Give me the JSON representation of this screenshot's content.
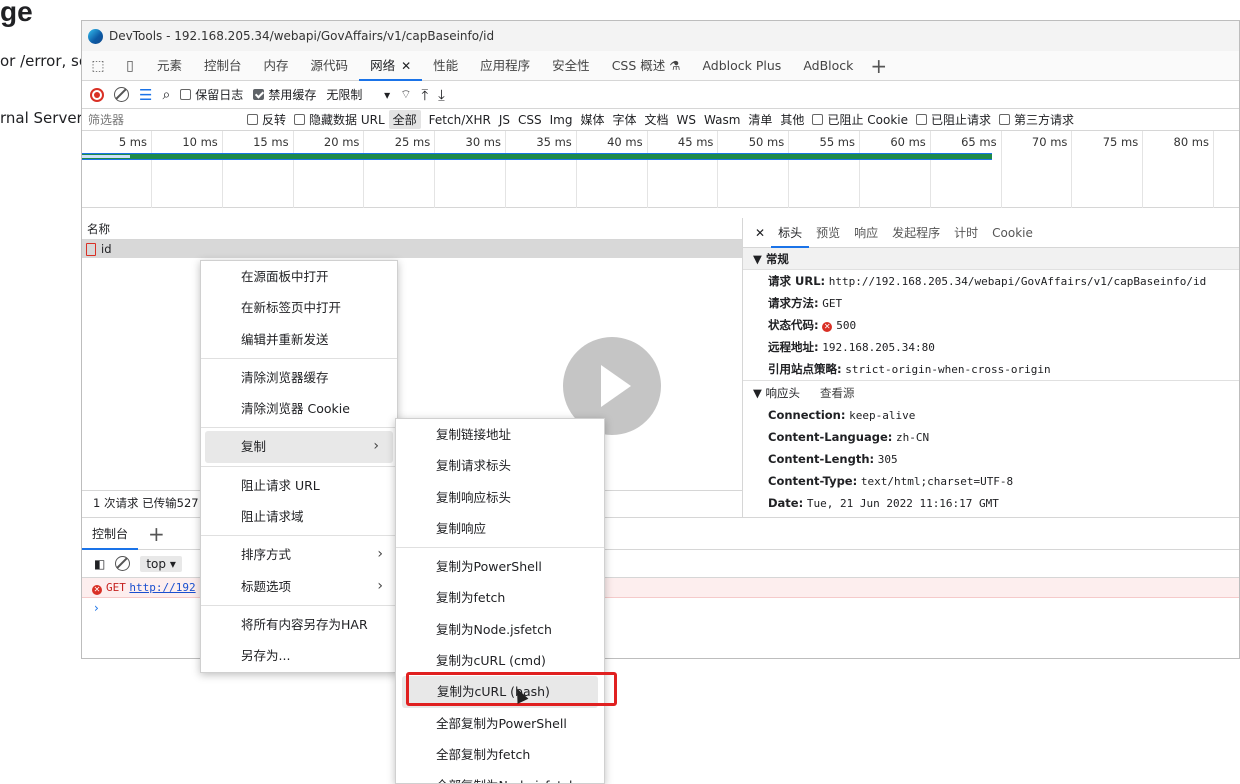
{
  "background": {
    "heading": "ge",
    "line1": "or /error, so",
    "line2": "rnal Server"
  },
  "window": {
    "title": "DevTools - 192.168.205.34/webapi/GovAffairs/v1/capBaseinfo/id"
  },
  "tabs": [
    "元素",
    "控制台",
    "内存",
    "源代码",
    "网络",
    "性能",
    "应用程序",
    "安全性",
    "CSS 概述 ⚗",
    "Adblock Plus",
    "AdBlock"
  ],
  "active_tab": "网络",
  "toolbar": {
    "preserve_log": "保留日志",
    "disable_cache": "禁用缓存",
    "throttle": "无限制"
  },
  "filterbar": {
    "placeholder": "筛选器",
    "invert": "反转",
    "hide_data_url": "隐藏数据 URL",
    "types": [
      "全部",
      "Fetch/XHR",
      "JS",
      "CSS",
      "Img",
      "媒体",
      "字体",
      "文档",
      "WS",
      "Wasm",
      "清单",
      "其他"
    ],
    "blocked_cookies": "已阻止 Cookie",
    "blocked_requests": "已阻止请求",
    "third_party": "第三方请求"
  },
  "timeline_ticks": [
    "5 ms",
    "10 ms",
    "15 ms",
    "20 ms",
    "25 ms",
    "30 ms",
    "35 ms",
    "40 ms",
    "45 ms",
    "50 ms",
    "55 ms",
    "60 ms",
    "65 ms",
    "70 ms",
    "75 ms",
    "80 ms"
  ],
  "requests": {
    "column": "名称",
    "rows": [
      "id"
    ],
    "status": "1 次请求  已传输527"
  },
  "details": {
    "tabs": [
      "标头",
      "预览",
      "响应",
      "发起程序",
      "计时",
      "Cookie"
    ],
    "general_title": "常规",
    "general": {
      "url_label": "请求 URL:",
      "url": "http://192.168.205.34/webapi/GovAffairs/v1/capBaseinfo/id",
      "method_label": "请求方法:",
      "method": "GET",
      "status_label": "状态代码:",
      "status": "500",
      "remote_label": "远程地址:",
      "remote": "192.168.205.34:80",
      "referrer_label": "引用站点策略:",
      "referrer": "strict-origin-when-cross-origin"
    },
    "response_headers_title": "响应头",
    "view_source": "查看源",
    "headers": [
      {
        "k": "Connection:",
        "v": "keep-alive"
      },
      {
        "k": "Content-Language:",
        "v": "zh-CN"
      },
      {
        "k": "Content-Length:",
        "v": "305"
      },
      {
        "k": "Content-Type:",
        "v": "text/html;charset=UTF-8"
      },
      {
        "k": "Date:",
        "v": "Tue, 21 Jun 2022 11:16:17 GMT"
      }
    ]
  },
  "drawer": {
    "tab": "控制台",
    "context": "top",
    "error_method": "GET",
    "error_link": "http://192"
  },
  "menu1": {
    "items": [
      "在源面板中打开",
      "在新标签页中打开",
      "编辑并重新发送",
      "清除浏览器缓存",
      "清除浏览器 Cookie",
      "复制",
      "阻止请求 URL",
      "阻止请求域",
      "排序方式",
      "标题选项",
      "将所有内容另存为HAR",
      "另存为..."
    ]
  },
  "menu2": {
    "items": [
      "复制链接地址",
      "复制请求标头",
      "复制响应标头",
      "复制响应",
      "复制为PowerShell",
      "复制为fetch",
      "复制为Node.jsfetch",
      "复制为cURL (cmd)",
      "复制为cURL (bash)",
      "全部复制为PowerShell",
      "全部复制为fetch",
      "全部复制为Node.jsfetch"
    ]
  },
  "colors": {
    "accent": "#1a73e8",
    "error": "#d93025",
    "highlight_box": "#e02020"
  }
}
